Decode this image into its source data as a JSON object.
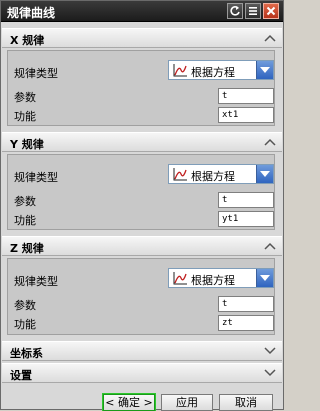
{
  "window": {
    "title": "规律曲线"
  },
  "sections": [
    {
      "header": "X 规律",
      "law_type_label": "规律类型",
      "law_type_value": "根据方程",
      "param_label": "参数",
      "param_value": "t",
      "func_label": "功能",
      "func_value": "xt1"
    },
    {
      "header": "Y 规律",
      "law_type_label": "规律类型",
      "law_type_value": "根据方程",
      "param_label": "参数",
      "param_value": "t",
      "func_label": "功能",
      "func_value": "yt1"
    },
    {
      "header": "Z 规律",
      "law_type_label": "规律类型",
      "law_type_value": "根据方程",
      "param_label": "参数",
      "param_value": "t",
      "func_label": "功能",
      "func_value": "zt"
    }
  ],
  "collapsed_sections": [
    {
      "header": "坐标系"
    },
    {
      "header": "设置"
    }
  ],
  "buttons": {
    "ok": "< 确定 >",
    "apply": "应用",
    "cancel": "取消"
  }
}
